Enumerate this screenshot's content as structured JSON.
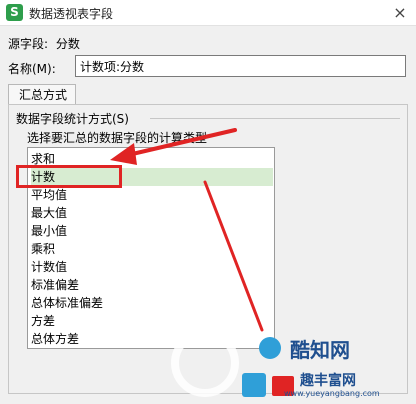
{
  "window": {
    "title": "数据透视表字段",
    "app_icon_letter": "S",
    "close_glyph": "×"
  },
  "source_field": {
    "label": "源字段:",
    "value": "分数"
  },
  "name_field": {
    "label": "名称(M):",
    "value": "计数项:分数"
  },
  "tab": {
    "label": "汇总方式"
  },
  "group": {
    "title": "数据字段统计方式(S)",
    "instruction": "选择要汇总的数据字段的计算类型"
  },
  "list": {
    "items": [
      "求和",
      "计数",
      "平均值",
      "最大值",
      "最小值",
      "乘积",
      "计数值",
      "标准偏差",
      "总体标准偏差",
      "方差",
      "总体方差"
    ],
    "selected_index": 1
  },
  "watermark": {
    "brand1": "酷知网",
    "brand2": "趣丰富网",
    "url": "www.yueyangbang.com"
  },
  "colors": {
    "accent_red": "#e02424",
    "app_green": "#2e9e4c",
    "selection": "#d7ecd1"
  },
  "icons": {
    "app": "spreadsheet-app-icon",
    "close": "close-icon",
    "annotation": "red-arrow-icon"
  }
}
